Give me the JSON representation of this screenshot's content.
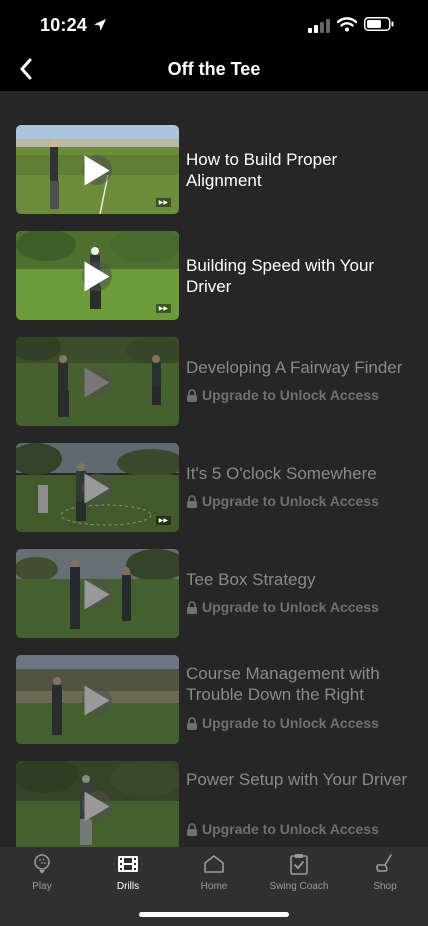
{
  "status_bar": {
    "time": "10:24"
  },
  "nav": {
    "title": "Off the Tee"
  },
  "videos": [
    {
      "title": "How to Build Proper Alignment",
      "locked": false
    },
    {
      "title": "Building Speed with Your Driver",
      "locked": false
    },
    {
      "title": "Developing A Fairway Finder",
      "locked": true,
      "lock_text": "Upgrade to Unlock Access"
    },
    {
      "title": "It's 5 O'clock Somewhere",
      "locked": true,
      "lock_text": "Upgrade to Unlock Access"
    },
    {
      "title": "Tee Box Strategy",
      "locked": true,
      "lock_text": "Upgrade to Unlock Access"
    },
    {
      "title": "Course Management with Trouble Down the Right",
      "locked": true,
      "lock_text": "Upgrade to Unlock Access"
    },
    {
      "title": "Power Setup with Your Driver",
      "locked": true,
      "lock_text": "Upgrade to Unlock Access"
    }
  ],
  "tabs": [
    {
      "label": "Play",
      "icon": "golf-ball-icon",
      "active": false
    },
    {
      "label": "Drills",
      "icon": "film-icon",
      "active": true
    },
    {
      "label": "Home",
      "icon": "home-icon",
      "active": false
    },
    {
      "label": "Swing Coach",
      "icon": "clipboard-check-icon",
      "active": false
    },
    {
      "label": "Shop",
      "icon": "golf-club-icon",
      "active": false
    }
  ],
  "colors": {
    "background": "#262626",
    "bars": "#000000",
    "tab_bar": "#303030",
    "locked_text": "#707070"
  }
}
